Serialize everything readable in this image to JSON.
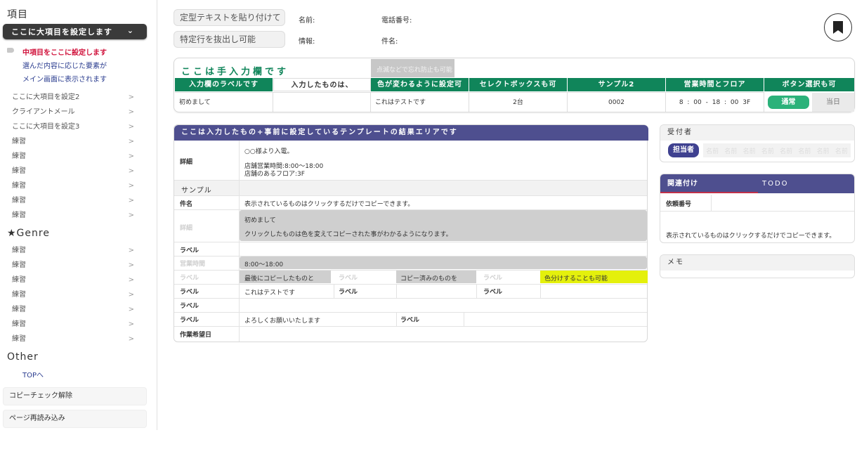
{
  "sidebar": {
    "heading_items": "項目",
    "main_button": "ここに大項目を設定します",
    "subitems": [
      "中項目をここに設定します",
      "選んだ内容に応じた要素が",
      "メイン画面に表示されます"
    ],
    "items": [
      "ここに大項目を設定2",
      "クライアントメール",
      "ここに大項目を設定3",
      "練習",
      "練習",
      "練習",
      "練習",
      "練習",
      "練習"
    ],
    "heading_genre": "★Genre",
    "genre_items": [
      "練習",
      "練習",
      "練習",
      "練習",
      "練習",
      "練習",
      "練習"
    ],
    "heading_other": "Other",
    "top_link": "TOPへ",
    "copy_check_button": "コピーチェック解除",
    "reload_button": "ページ再読み込み"
  },
  "header": {
    "paste_button": "定型テキストを貼り付けて",
    "extract_button": "特定行を抜出し可能",
    "name_label": "名前:",
    "phone_label": "電話番号:",
    "info_label": "情報:",
    "subject_label": "件名:"
  },
  "input_panel": {
    "title": "ここは手入力欄です",
    "note": "点滅などで忘れ防止も可能",
    "headers": [
      "入力欄のラベルです",
      "入力したものは、",
      "色が変わるように設定可",
      "セレクトボックスも可",
      "サンプル2",
      "営業時間とフロア",
      "ボタン選択も可"
    ],
    "values": [
      "初めまして",
      "",
      "これはテストです",
      "2台",
      "0002",
      "8 : 00 - 18 : 00 3F"
    ],
    "status_button": "通常",
    "today_button": "当日"
  },
  "result": {
    "title": "ここは入力したもの+事前に設定しているテンプレートの結果エリアです",
    "detail_label": "詳細",
    "detail_lines": [
      "○○様より入電。",
      "店舗営業時間:8:00〜18:00",
      "店舗のあるフロア:3F"
    ],
    "sample_section": "サンプル",
    "subject_label": "件名",
    "subject_value": "表示されているものはクリックするだけでコピーできます。",
    "detail2_label": "詳細",
    "detail2_lines": [
      "初めまして",
      "クリックしたものは色を変えてコピーされた事がわかるようになります。"
    ],
    "label": "ラベル",
    "hours_label": "営業時間",
    "hours_value": "8:00〜18:00",
    "last_copied": "最後にコピーしたものと",
    "copied": "コピー済みのものを",
    "color_coding": "色分けすることも可能",
    "test_value": "これはテストです",
    "thanks_value": "よろしくお願いいたします",
    "work_date_label": "作業希望日"
  },
  "receiver": {
    "title": "受付者",
    "tanto_button": "担当者",
    "names": [
      "名前",
      "名前",
      "名前",
      "名前",
      "名前",
      "名前",
      "名前",
      "名前"
    ]
  },
  "related": {
    "tab_related": "関連付け",
    "tab_todo": "TODO",
    "request_no_label": "依頼番号",
    "copy_note": "表示されているものはクリックするだけでコピーできます。"
  },
  "memo": {
    "title": "メモ"
  },
  "colors": {
    "green": "#10855a",
    "navy": "#4e4f8f",
    "accent_red": "#d0103a",
    "highlight_yellow": "#e4f00c"
  }
}
